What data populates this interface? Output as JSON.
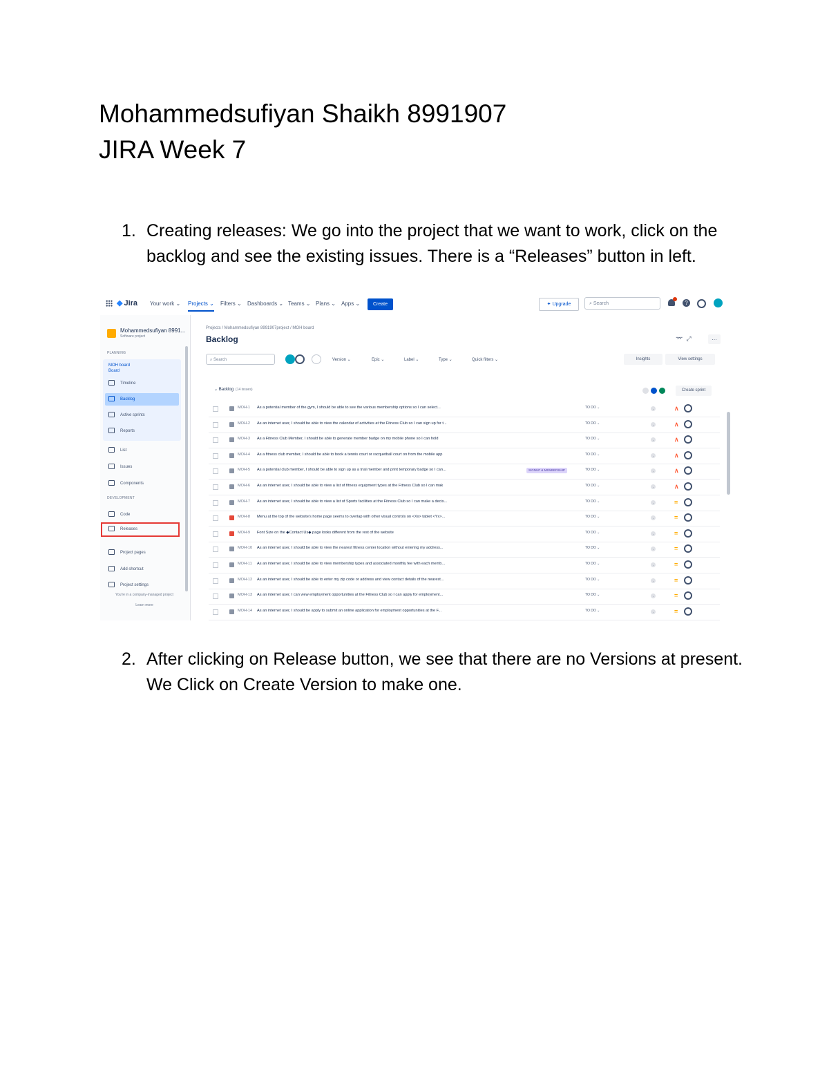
{
  "document": {
    "title_line1": "Mohammedsufiyan Shaikh 8991907",
    "title_line2": "JIRA Week 7",
    "steps": [
      {
        "number": "1.",
        "text": "Creating releases: We go into the project that we want to work, click on the backlog and see the existing issues. There is a “Releases” button in left."
      },
      {
        "number": "2.",
        "text": "After clicking on Release button, we see that there are no Versions at present. We Click on Create Version to make one."
      }
    ]
  },
  "jira": {
    "topbar": {
      "logo": "Jira",
      "nav": [
        "Your work ⌄",
        "Projects ⌄",
        "Filters ⌄",
        "Dashboards ⌄",
        "Teams ⌄",
        "Plans ⌄",
        "Apps ⌄"
      ],
      "create": "Create",
      "upgrade": "✦ Upgrade",
      "search_placeholder": "⌕ Search",
      "help_glyph": "?"
    },
    "sidebar": {
      "project_name": "Mohammedsufiyan 8991...",
      "project_sub": "Software project",
      "planning_label": "PLANNING",
      "board_name": "MOH board",
      "board_sub": "Board",
      "items": [
        "Timeline",
        "Backlog",
        "Active sprints",
        "Reports",
        "List",
        "Issues",
        "Components"
      ],
      "development_label": "DEVELOPMENT",
      "dev_items": [
        "Code",
        "Releases"
      ],
      "bottom_items": [
        "Project pages",
        "Add shortcut",
        "Project settings"
      ],
      "footer": "You're in a company-managed project",
      "learn_more": "Learn more"
    },
    "main": {
      "breadcrumb": "Projects  /  Mohammedsufiyan 8991907project  /  MOH board",
      "title": "Backlog",
      "share": "⌤",
      "expand": "⤢",
      "more": "…",
      "search_placeholder": "⌕ Search",
      "filters": [
        "Version ⌄",
        "Epic ⌄",
        "Label ⌄",
        "Type ⌄",
        "Quick filters ⌄"
      ],
      "insights": "Insights",
      "view_settings": "View settings",
      "sprint_label": "⌄ Backlog",
      "sprint_count": "(14 issues)",
      "pill_values": [
        "0",
        "0",
        "0"
      ],
      "create_sprint": "Create sprint",
      "issues": [
        {
          "key": "MOH-1",
          "summary": "As a potential member of the gym, I should be able to see the various membership options so I can select...",
          "status": "TO DO ⌄",
          "estimate": "-",
          "priority": "∧",
          "epic": "",
          "type": "story"
        },
        {
          "key": "MOH-2",
          "summary": "As an internet user, I should be able to view the calendar of activities at the Fitness Club so I can sign up for t...",
          "status": "TO DO ⌄",
          "estimate": "-",
          "priority": "∧",
          "epic": "",
          "type": "story"
        },
        {
          "key": "MOH-3",
          "summary": "As a Fitness Club Member, I should be able to generate member badge on my mobile phone so I can hold",
          "status": "TO DO ⌄",
          "estimate": "-",
          "priority": "∧",
          "epic": "",
          "type": "story"
        },
        {
          "key": "MOH-4",
          "summary": "As a fitness club member, I should be able to book a tennis court or racquetball court on from the mobile app",
          "status": "TO DO ⌄",
          "estimate": "-",
          "priority": "∧",
          "epic": "",
          "type": "story"
        },
        {
          "key": "MOH-5",
          "summary": "As a potential club member, I should be able to sign up as a trial member and print temporary badge so I can...",
          "status": "TO DO ⌄",
          "estimate": "-",
          "priority": "∧",
          "epic": "SIGNUP & MEMBERSHIP",
          "type": "story"
        },
        {
          "key": "MOH-6",
          "summary": "As an internet user, I should be able to view a list of fitness equipment types at the Fitness Club so I can mak",
          "status": "TO DO ⌄",
          "estimate": "-",
          "priority": "∧",
          "epic": "",
          "type": "story"
        },
        {
          "key": "MOH-7",
          "summary": "As an internet user, I should be able to view a list of Sports facilities at the Fitness Club so I can make a decis...",
          "status": "TO DO ⌄",
          "estimate": "-",
          "priority": "=",
          "epic": "",
          "type": "story"
        },
        {
          "key": "MOH-8",
          "summary": "Menu at the top of the website's home page seems to overlap with other visual controls on <Xx> tablet <Yx>...",
          "status": "TO DO ⌄",
          "estimate": "-",
          "priority": "=",
          "epic": "",
          "type": "bug"
        },
        {
          "key": "MOH-9",
          "summary": "Font Size on the ◆Contact Us◆ page looks different from the rest of the website",
          "status": "TO DO ⌄",
          "estimate": "-",
          "priority": "=",
          "epic": "",
          "type": "bug"
        },
        {
          "key": "MOH-10",
          "summary": "As an internet user, I should be able to view the nearest fitness center location without entering my address...",
          "status": "TO DO ⌄",
          "estimate": "-",
          "priority": "=",
          "epic": "",
          "type": "story"
        },
        {
          "key": "MOH-11",
          "summary": "As an internet user, I should be able to view membership types and associated monthly fee with each memb...",
          "status": "TO DO ⌄",
          "estimate": "-",
          "priority": "=",
          "epic": "",
          "type": "story"
        },
        {
          "key": "MOH-12",
          "summary": "As an internet user, I should be able to enter my zip code or address and view contact details of the nearest...",
          "status": "TO DO ⌄",
          "estimate": "-",
          "priority": "=",
          "epic": "",
          "type": "story"
        },
        {
          "key": "MOH-13",
          "summary": "As an internet user, I can view employment opportunities at the Fitness Club so I can apply for employment...",
          "status": "TO DO ⌄",
          "estimate": "-",
          "priority": "=",
          "epic": "",
          "type": "story"
        },
        {
          "key": "MOH-14",
          "summary": "As an internet user, I should be apply to submit an online application for employment opportunities at the F...",
          "status": "TO DO ⌄",
          "estimate": "-",
          "priority": "=",
          "epic": "",
          "type": "story"
        }
      ]
    },
    "colors": {
      "accent": "#0052cc",
      "story": "#8993a4",
      "bug": "#e5493a",
      "priority_high": "#ff5630",
      "priority_medium": "#ffab00",
      "highlight": "#e53935"
    }
  }
}
